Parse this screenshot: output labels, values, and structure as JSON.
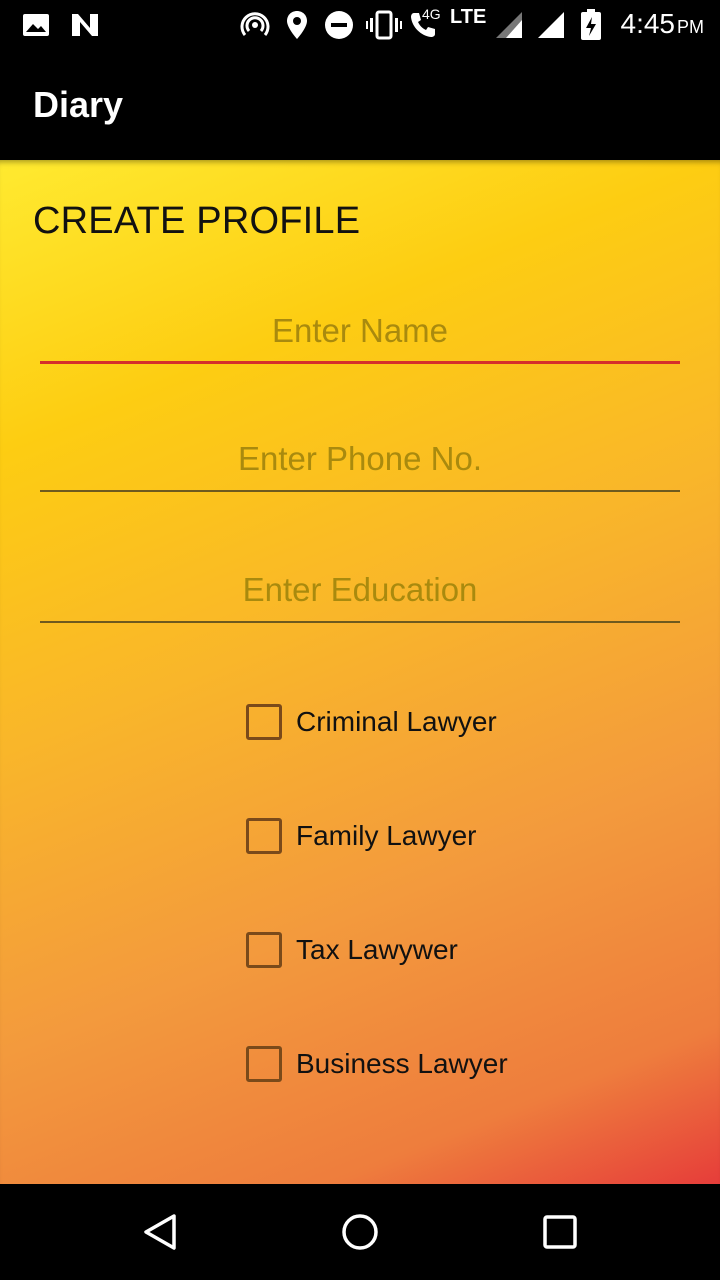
{
  "status_bar": {
    "time": "4:45",
    "ampm": "PM",
    "network_label": "LTE",
    "network_small": "4G",
    "icons": [
      "image-icon",
      "n-icon",
      "hotspot-icon",
      "location-icon",
      "dnd-icon",
      "vibrate-icon",
      "call-icon",
      "signal-icon",
      "signal-icon",
      "battery-icon"
    ]
  },
  "appbar": {
    "title": "Diary"
  },
  "form": {
    "heading": "CREATE PROFILE",
    "name_placeholder": "Enter Name",
    "phone_placeholder": "Enter Phone No.",
    "education_placeholder": "Enter Education",
    "options": [
      {
        "label": "Criminal Lawyer",
        "checked": false
      },
      {
        "label": "Family Lawyer",
        "checked": false
      },
      {
        "label": "Tax Lawywer",
        "checked": false
      },
      {
        "label": "Business Lawyer",
        "checked": false
      }
    ]
  },
  "colors": {
    "accent": "#d52f2b",
    "placeholder": "#a98a0e",
    "checkbox_border": "#7a4a1a"
  },
  "navbar": {
    "icons": [
      "back-icon",
      "home-icon",
      "recents-icon"
    ]
  }
}
